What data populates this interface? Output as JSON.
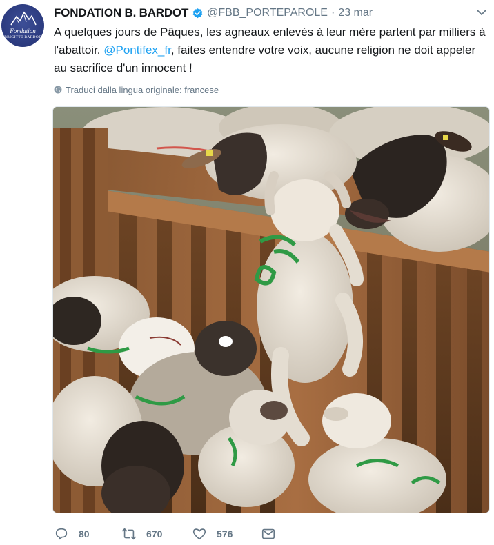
{
  "account": {
    "display_name": "FONDATION B. BARDOT",
    "handle": "@FBB_PORTEPAROLE",
    "separator": "·",
    "time": "23 mar",
    "avatar_text_line1": "Fondation",
    "avatar_text_line2": "BRIGITTE BARDOT",
    "verified": true
  },
  "tweet": {
    "text_part1": "A quelques jours de Pâques, les agneaux enlevés à leur mère partent par milliers à l'abattoir. ",
    "mention": "@Pontifex_fr",
    "text_part2": ", faites entendre votre voix, aucune religion ne doit appeler au sacrifice d'un innocent !",
    "translate_label": "Traduci dalla lingua originale: francese"
  },
  "actions": {
    "reply_count": "80",
    "retweet_count": "670",
    "like_count": "576"
  },
  "icons": {
    "verified": "verified-badge-icon",
    "caret": "chevron-down-icon",
    "globe": "globe-icon",
    "reply": "reply-icon",
    "retweet": "retweet-icon",
    "like": "heart-icon",
    "message": "envelope-icon"
  },
  "colors": {
    "link": "#1da1f2",
    "verified": "#1da1f2",
    "secondary_text": "#657786",
    "avatar_bg": "#2b3a7e"
  }
}
